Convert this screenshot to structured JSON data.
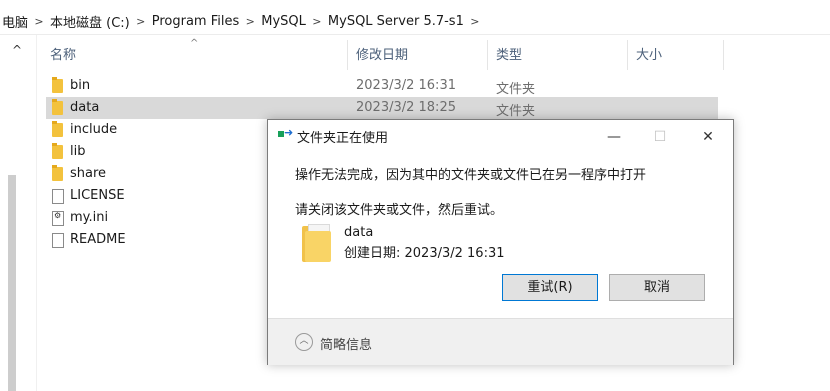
{
  "breadcrumb": [
    "电脑",
    "本地磁盘 (C:)",
    "Program Files",
    "MySQL",
    "MySQL Server 5.7-s1"
  ],
  "columns": {
    "name": "名称",
    "date": "修改日期",
    "type": "类型",
    "size": "大小"
  },
  "files": [
    {
      "name": "bin",
      "date": "2023/3/2 16:31",
      "type": "文件夹",
      "icon": "folder-icon"
    },
    {
      "name": "data",
      "date": "2023/3/2 18:25",
      "type": "文件夹",
      "icon": "folder-icon"
    },
    {
      "name": "include",
      "date": "",
      "type": "",
      "icon": "folder-icon"
    },
    {
      "name": "lib",
      "date": "",
      "type": "",
      "icon": "folder-icon"
    },
    {
      "name": "share",
      "date": "",
      "type": "",
      "icon": "folder-icon"
    },
    {
      "name": "LICENSE",
      "date": "",
      "type": "",
      "icon": "file-icon"
    },
    {
      "name": "my.ini",
      "date": "",
      "type": "",
      "icon": "ini-file-icon"
    },
    {
      "name": "README",
      "date": "",
      "type": "",
      "icon": "file-icon"
    }
  ],
  "dialog": {
    "title": "文件夹正在使用",
    "minimize": "—",
    "maximize": "☐",
    "close": "✕",
    "message_line1": "操作无法完成，因为其中的文件夹或文件已在另一程序中打开",
    "message_line2": "请关闭该文件夹或文件，然后重试。",
    "item_name": "data",
    "item_created": "创建日期: 2023/3/2 16:31",
    "retry_button": "重试(R)",
    "cancel_button": "取消",
    "details_label": "简略信息",
    "details_glyph": "︿"
  },
  "scroll_up_glyph": "^",
  "sort_glyph": "^"
}
